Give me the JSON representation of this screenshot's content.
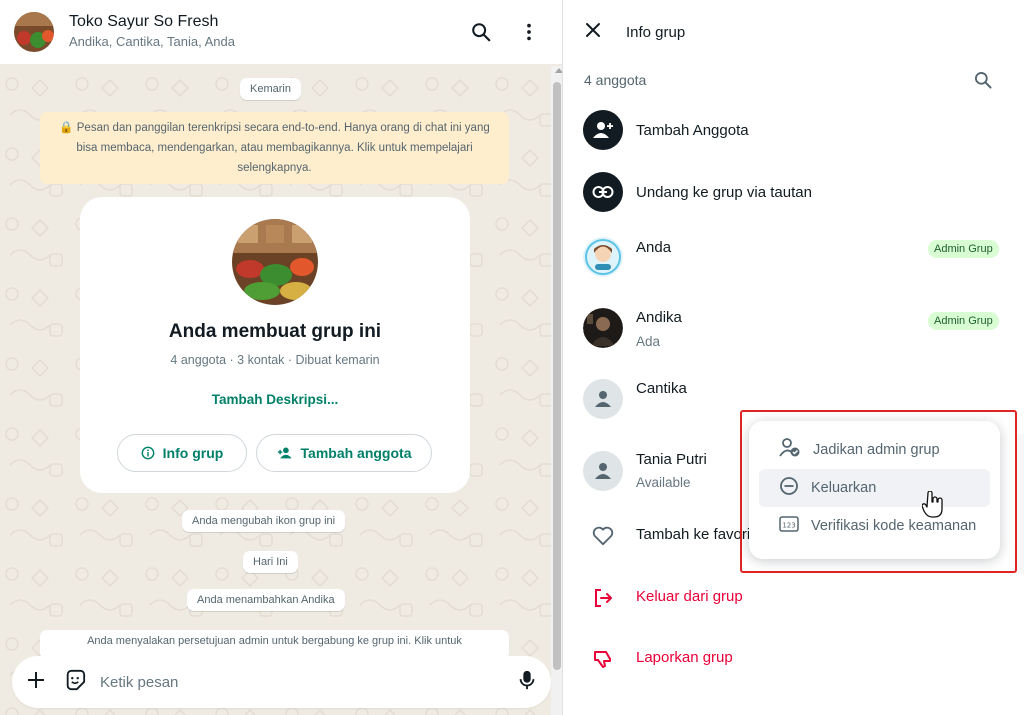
{
  "chat": {
    "title": "Toko Sayur So Fresh",
    "subtitle": "Andika, Cantika, Tania, Anda",
    "icons": {
      "search": "search-icon",
      "menu": "more-vertical-icon"
    }
  },
  "messages": {
    "day_yesterday": "Kemarin",
    "encryption": "🔒 Pesan dan panggilan terenkripsi secara end-to-end. Hanya orang di chat ini yang bisa membaca, mendengarkan, atau membagikannya. Klik untuk mempelajari selengkapnya.",
    "card": {
      "title": "Anda membuat grup ini",
      "subtitle": "4 anggota · 3 kontak · Dibuat kemarin",
      "add_description": "Tambah Deskripsi...",
      "info_button": "Info grup",
      "add_member_button": "Tambah anggota"
    },
    "system_changed_icon": "Anda mengubah ikon grup ini",
    "day_today": "Hari Ini",
    "system_added": "Anda menambahkan Andika",
    "system_approval": "Anda menyalakan persetujuan admin untuk bergabung ke grup ini. Klik untuk"
  },
  "composer": {
    "placeholder": "Ketik pesan"
  },
  "info": {
    "title": "Info grup",
    "members_count": "4 anggota",
    "add_member": "Tambah Anggota",
    "invite_link": "Undang ke grup via tautan",
    "members": [
      {
        "name": "Anda",
        "status": "",
        "badge": "Admin Grup"
      },
      {
        "name": "Andika",
        "status": "Ada",
        "badge": "Admin Grup"
      },
      {
        "name": "Cantika",
        "status": "",
        "badge": ""
      },
      {
        "name": "Tania Putri",
        "status": "Available",
        "badge": ""
      }
    ],
    "add_favorite": "Tambah ke favorit",
    "leave_group": "Keluar dari grup",
    "report_group": "Laporkan grup"
  },
  "context_menu": {
    "items": [
      {
        "label": "Jadikan admin grup",
        "icon": "user-check-icon"
      },
      {
        "label": "Keluarkan",
        "icon": "minus-circle-icon"
      },
      {
        "label": "Verifikasi kode keamanan",
        "icon": "number-pad-icon"
      }
    ],
    "hovered_index": 1
  },
  "colors": {
    "accent_green": "#008069",
    "danger_red": "#ea0038",
    "highlight_border": "#e02424",
    "encryption_bg": "#ffeecd"
  }
}
